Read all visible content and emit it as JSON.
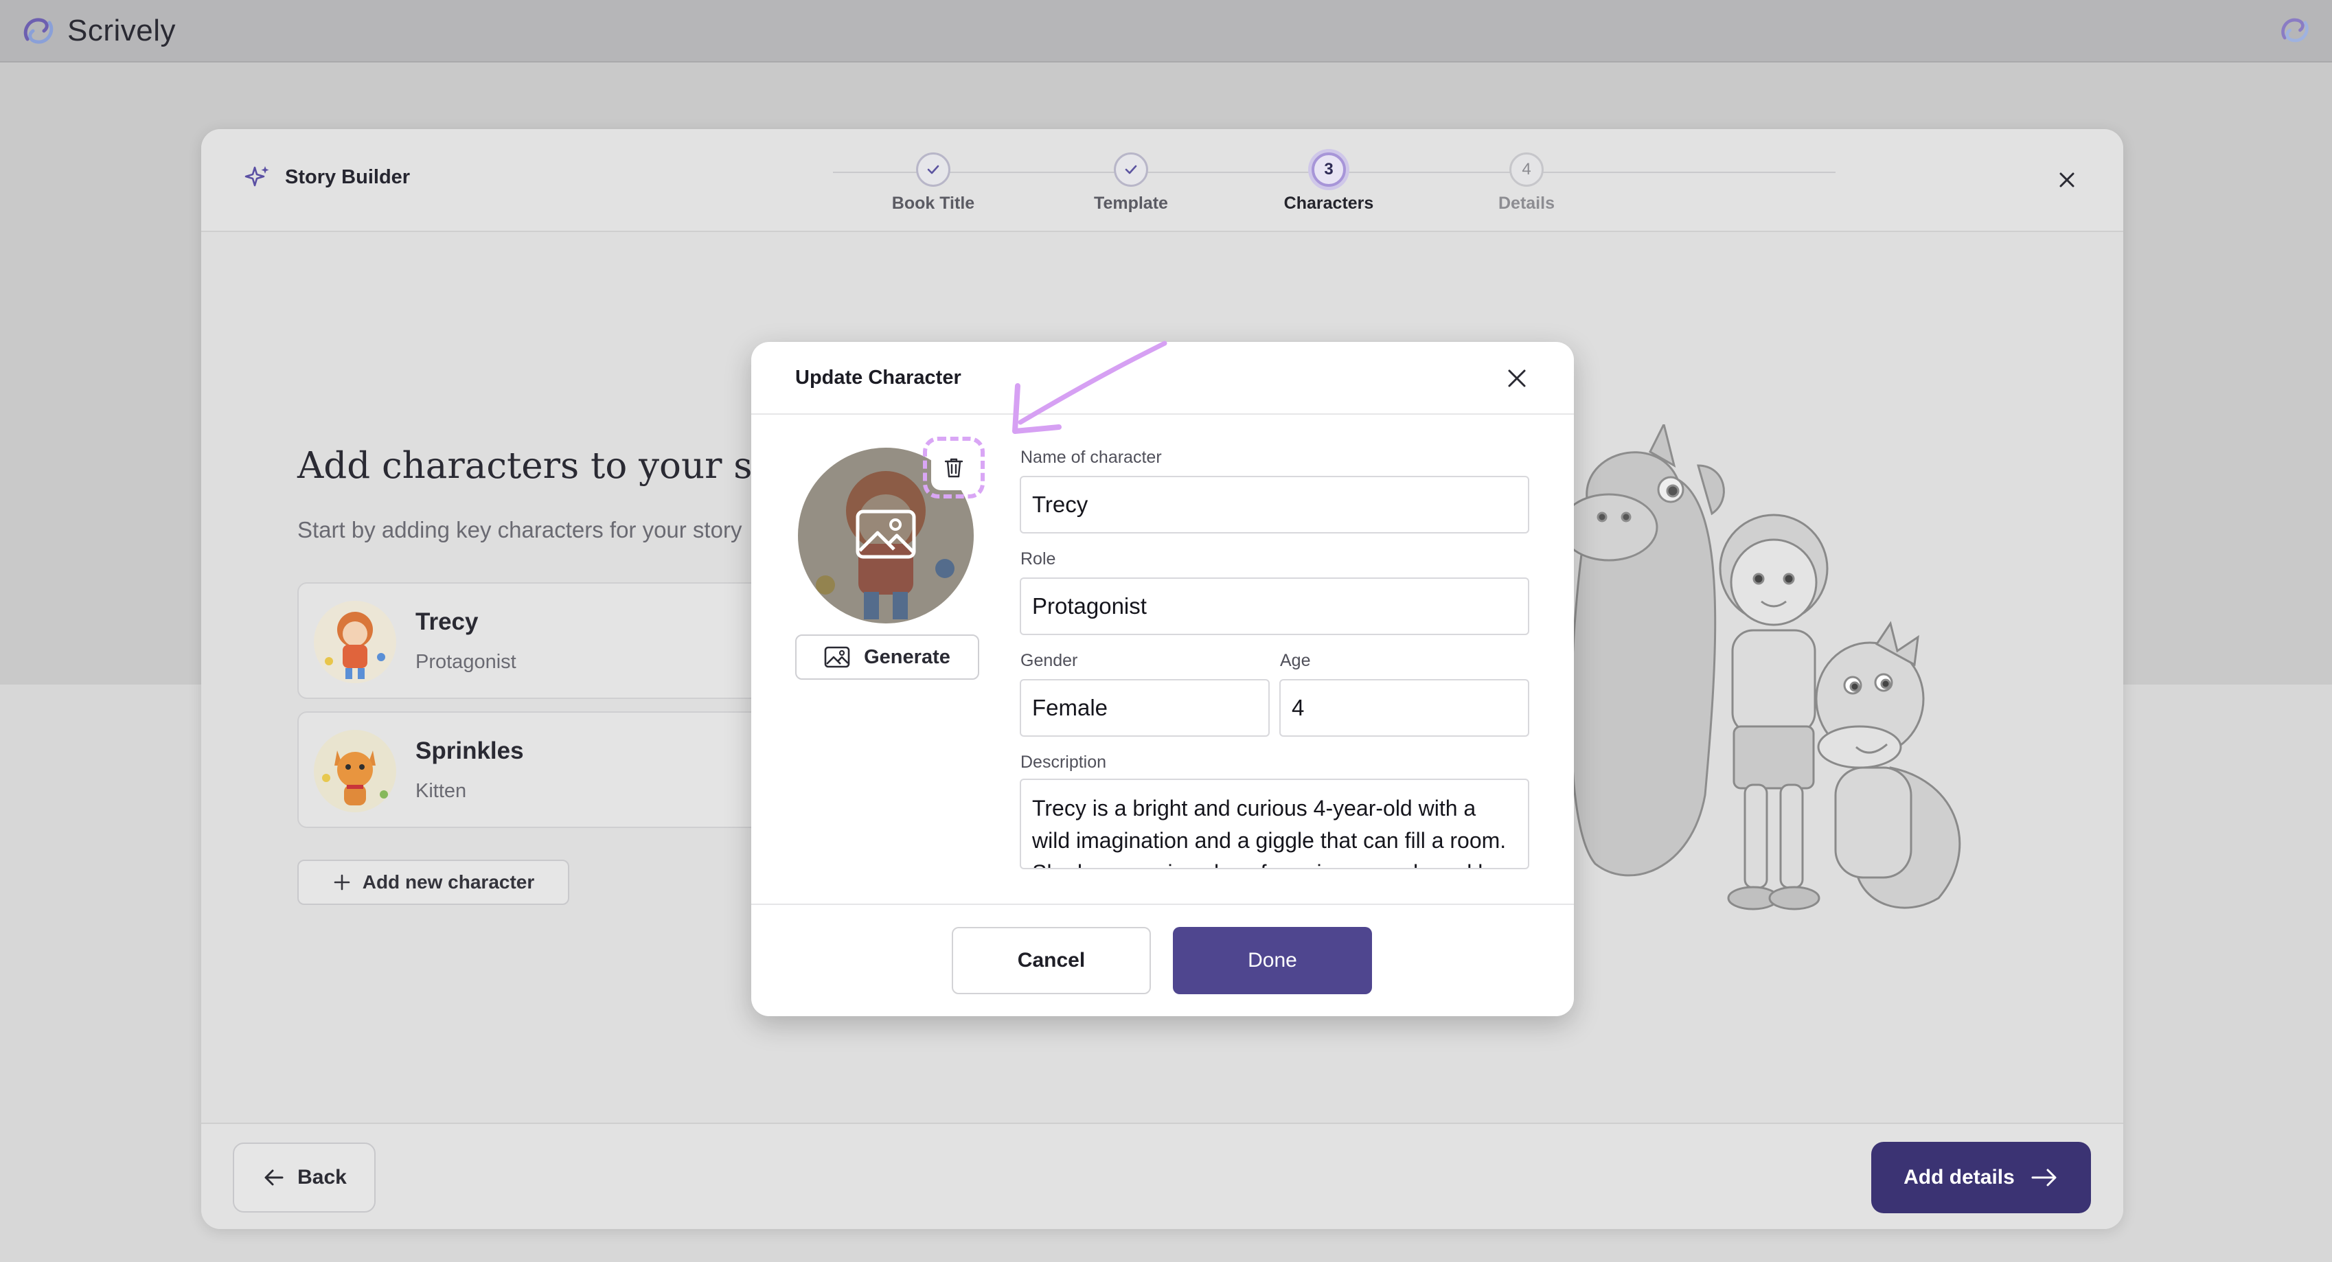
{
  "app": {
    "brand_name": "Scrively",
    "accent": "#3b3373",
    "logo_icon": "swirl-logo-icon"
  },
  "builder": {
    "title": "Story Builder",
    "steps": [
      {
        "number": "1",
        "label": "Book Title",
        "state": "complete"
      },
      {
        "number": "2",
        "label": "Template",
        "state": "complete"
      },
      {
        "number": "3",
        "label": "Characters",
        "state": "current"
      },
      {
        "number": "4",
        "label": "Details",
        "state": "future"
      }
    ],
    "heading": "Add characters to your story",
    "subheading": "Start by adding key characters for your story",
    "characters": [
      {
        "name": "Trecy",
        "role": "Protagonist"
      },
      {
        "name": "Sprinkles",
        "role": "Kitten"
      }
    ],
    "add_character_label": "Add new character",
    "back_label": "Back",
    "next_label": "Add details"
  },
  "modal": {
    "title": "Update Character",
    "generate_label": "Generate",
    "name_label": "Name of character",
    "name_value": "Trecy",
    "role_label": "Role",
    "role_value": "Protagonist",
    "gender_label": "Gender",
    "gender_value": "Female",
    "age_label": "Age",
    "age_value": "4",
    "description_label": "Description",
    "description_value": "Trecy is a bright and curious 4-year-old with a wild imagination and a giggle that can fill a room. She has a curious love for unicorns and sparkly things.",
    "cancel_label": "Cancel",
    "done_label": "Done",
    "highlight_color": "#d9a6f5"
  }
}
